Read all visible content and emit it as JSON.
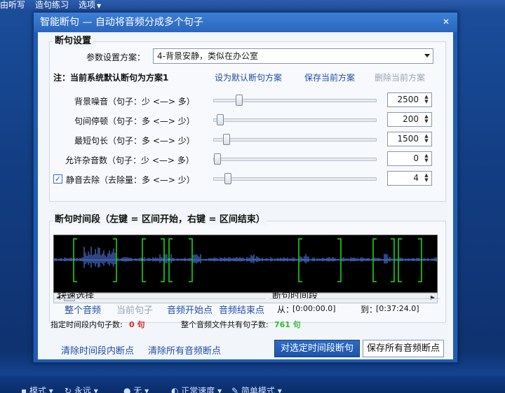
{
  "app_menu": {
    "item1": "由听写",
    "item2": "造句练习",
    "item3": "选项"
  },
  "app_bottom": {
    "tool1": "模式",
    "tool2": "永远",
    "tool3": "无",
    "tool4": "正常速度",
    "tool5": "简单模式"
  },
  "dialog": {
    "title": "智能断句 — 自动将音频分成多个句子",
    "close_glyph": "✕"
  },
  "settings": {
    "group_title": "断句设置",
    "scheme_label": "参数设置方案：",
    "scheme_value": "4-背景安静，类似在办公室",
    "note": "注：当前系统默认断句为方案1",
    "set_default": "设为默认断句方案",
    "save_scheme": "保存当前方案",
    "delete_scheme": "删除当前方案",
    "params": [
      {
        "label": "背景噪音（句子：少 <—> 多）",
        "value": "2500",
        "level": 0.14
      },
      {
        "label": "句间停顿（句子：多 <—> 少）",
        "value": "200",
        "level": 0.02
      },
      {
        "label": "最短句长（句子：多 <—> 少）",
        "value": "1500",
        "level": 0.06
      },
      {
        "label": "允许杂音数（句子：少 <—> 多）",
        "value": "0",
        "level": 0.0
      },
      {
        "label": "静音去除（去除量：多 <—> 少）",
        "value": "4",
        "level": 0.07,
        "checked": true
      }
    ],
    "check_glyph": "✓",
    "spin_glyph_up": "▲",
    "spin_glyph_down": "▼"
  },
  "segment": {
    "group_title": "断句时间段（左键 = 区间开始，右键 = 区间结束）",
    "scroll_left": "◀",
    "scroll_right": "▶"
  },
  "quick": {
    "title": "快速选择",
    "whole_audio": "整个音频",
    "current_sentence": "当前句子",
    "audio_start": "音频开始点",
    "audio_end": "音频结束点",
    "in_range_label": "指定时间段内句子数:",
    "in_range_count": "0 句"
  },
  "range": {
    "title": "断句时间段",
    "from_label": "从：",
    "from_value": "[0:00:00.0]",
    "to_label": "到：",
    "to_value": "[0:37:24.0]",
    "total_label": "整个音频文件共有句子数:",
    "total_count": "761 句"
  },
  "actions": {
    "clear_range": "清除时间段内断点",
    "clear_all": "清除所有音频断点",
    "split_selected": "对选定时间段断句",
    "save_all": "保存所有音频断点"
  },
  "colors": {
    "window_blue": "#1f5db5",
    "wave_blue": "#5a8cff",
    "marker_green": "#1ee01e",
    "count_red": "#e02020",
    "count_green": "#2fbf2f"
  }
}
